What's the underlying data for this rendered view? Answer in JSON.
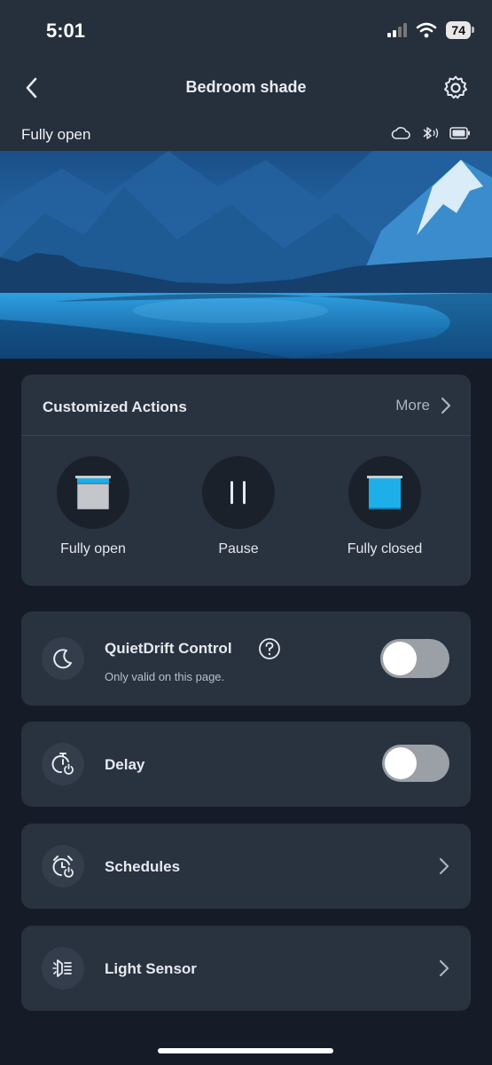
{
  "status_bar": {
    "time": "5:01",
    "battery": "74"
  },
  "nav": {
    "title": "Bedroom shade",
    "back_icon": "chevron-left-icon",
    "settings_icon": "gear-icon"
  },
  "device_state": {
    "label": "Fully open",
    "icons": [
      "cloud-icon",
      "bluetooth-icon",
      "battery-icon"
    ]
  },
  "actions": {
    "title": "Customized Actions",
    "more_label": "More",
    "items": [
      {
        "label": "Fully open",
        "icon": "shade-open-icon"
      },
      {
        "label": "Pause",
        "icon": "pause-icon"
      },
      {
        "label": "Fully closed",
        "icon": "shade-closed-icon"
      }
    ]
  },
  "settings": {
    "quietdrift": {
      "title": "QuietDrift Control",
      "subtitle": "Only valid on this page.",
      "enabled": false
    },
    "delay": {
      "title": "Delay",
      "enabled": false
    },
    "schedules": {
      "title": "Schedules"
    },
    "light_sensor": {
      "title": "Light Sensor"
    }
  },
  "colors": {
    "accent": "#1eaee8",
    "card": "#29323f",
    "background": "#151c28",
    "toggle_off": "#9aa0a6"
  }
}
